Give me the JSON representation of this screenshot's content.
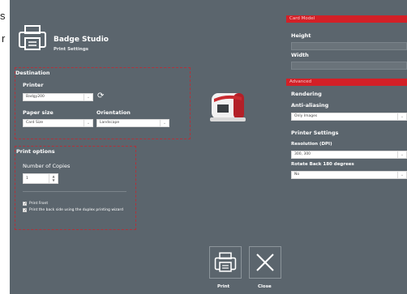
{
  "outside": {
    "left_top": "s",
    "left_mid": "r"
  },
  "app": {
    "title": "Badge Studio",
    "subtitle": "Print Settings"
  },
  "destination": {
    "title": "Destination",
    "printer_label": "Printer",
    "printer_value": "Badgy200",
    "paper_label": "Paper size",
    "paper_value": "Card Size",
    "orientation_label": "Orientation",
    "orientation_value": "Landscape"
  },
  "print_options": {
    "title": "Print options",
    "copies_label": "Number of Copies",
    "copies_value": "1",
    "print_front_label": "Print Front",
    "print_front_checked": true,
    "duplex_label": "Print the back side using the duplex printing wizard",
    "duplex_checked": true
  },
  "card_model": {
    "header": "Card Model",
    "height_label": "Height",
    "height_value": "",
    "width_label": "Width",
    "width_value": ""
  },
  "advanced": {
    "header": "Advanced",
    "rendering_label": "Rendering",
    "antialias_label": "Anti-aliasing",
    "antialias_value": "Only Images",
    "printer_settings_label": "Printer Settings",
    "resolution_label": "Resolution (DPI)",
    "resolution_value": "300, 300",
    "rotate_label": "Rotate Back 180 degrees",
    "rotate_value": "No"
  },
  "buttons": {
    "print_label": "Print",
    "close_label": "Close"
  },
  "colors": {
    "background": "#5b656d",
    "accent": "#d32027",
    "section_border": "#b0323b"
  },
  "icons": {
    "logo": "printer-icon",
    "refresh": "refresh-icon",
    "print": "printer-icon",
    "close": "close-icon"
  }
}
